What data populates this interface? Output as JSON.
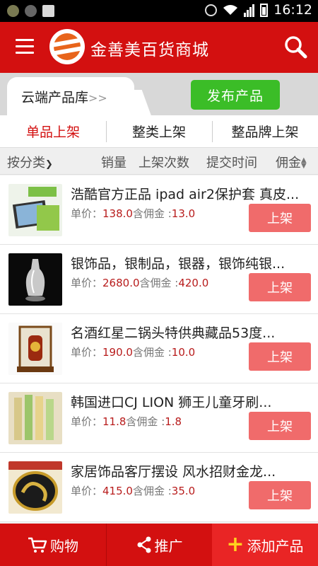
{
  "status_bar": {
    "time": "16:12",
    "icons": [
      "app-icon",
      "wechat-icon",
      "image-icon",
      "alarm-icon",
      "wifi-icon",
      "signal-icon",
      "battery-icon"
    ]
  },
  "header": {
    "title": "金善美百货商城",
    "menu_icon": "menu-icon",
    "search_icon": "search-icon"
  },
  "tab_row": {
    "cloud_tab": "云端产品库",
    "cloud_tab_arrow": ">>",
    "publish_button": "发布产品",
    "publish_color": "#3bbd27"
  },
  "segments": [
    {
      "label": "单品上架",
      "active": true
    },
    {
      "label": "整类上架",
      "active": false
    },
    {
      "label": "整品牌上架",
      "active": false
    }
  ],
  "sort": {
    "category": "按分类",
    "sales": "销量",
    "times": "上架次数",
    "submit": "提交时间",
    "commission": "佣金"
  },
  "products": [
    {
      "name": "浩酷官方正品 ipad air2保护套 真皮...",
      "price_label": "单价：",
      "price": "138.0",
      "comm_label": "含佣金 :",
      "commission": "13.0",
      "button": "上架"
    },
    {
      "name": "银饰品，银制品，银器，银饰纯银...",
      "price_label": "单价：",
      "price": "2680.0",
      "comm_label": "含佣金 :",
      "commission": "420.0",
      "button": "上架"
    },
    {
      "name": "名酒红星二锅头特供典藏品53度...",
      "price_label": "单价：",
      "price": "190.0",
      "comm_label": "含佣金 :",
      "commission": "10.0",
      "button": "上架"
    },
    {
      "name": "韩国进口CJ LION 狮王儿童牙刷...",
      "price_label": "单价：",
      "price": "11.8",
      "comm_label": "含佣金 :",
      "commission": "1.8",
      "button": "上架"
    },
    {
      "name": "家居饰品客厅摆设 风水招财金龙...",
      "price_label": "单价：",
      "price": "415.0",
      "comm_label": "含佣金 :",
      "commission": "35.0",
      "button": "上架"
    }
  ],
  "bottom_nav": {
    "shop": "购物",
    "promote": "推广",
    "add": "添加产品"
  },
  "colors": {
    "brand_red": "#d31010",
    "shelf_button": "#f06b6b",
    "price_red": "#b81c1c"
  }
}
